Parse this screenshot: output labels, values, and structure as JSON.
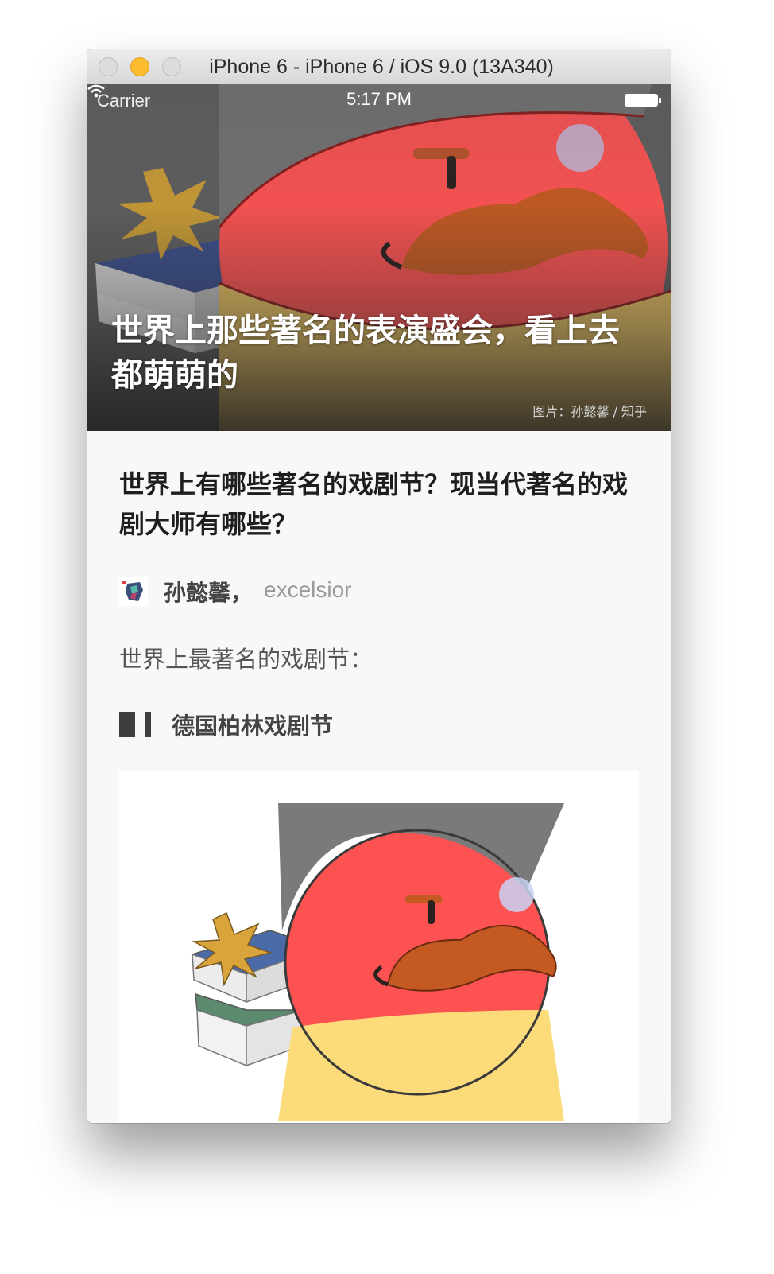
{
  "window": {
    "title": "iPhone 6 - iPhone 6 / iOS 9.0 (13A340)"
  },
  "status_bar": {
    "carrier": "Carrier",
    "time": "5:17 PM"
  },
  "hero": {
    "title": "世界上那些著名的表演盛会，看上去都萌萌的",
    "credit": "图片：孙懿馨 / 知乎"
  },
  "article": {
    "question_title": "世界上有哪些著名的戏剧节？现当代著名的戏剧大师有哪些？",
    "author_name": "孙懿馨，",
    "author_bio": "excelsior",
    "intro": "世界上最著名的戏剧节：",
    "section_heading": "德国柏林戏剧节"
  },
  "colors": {
    "flag_black": "#6f6f6f",
    "flag_red": "#fc5252",
    "flag_gold": "#fcdb7a",
    "mustache": "#c45a22",
    "traffic_minimize": "#fdbc2f"
  }
}
